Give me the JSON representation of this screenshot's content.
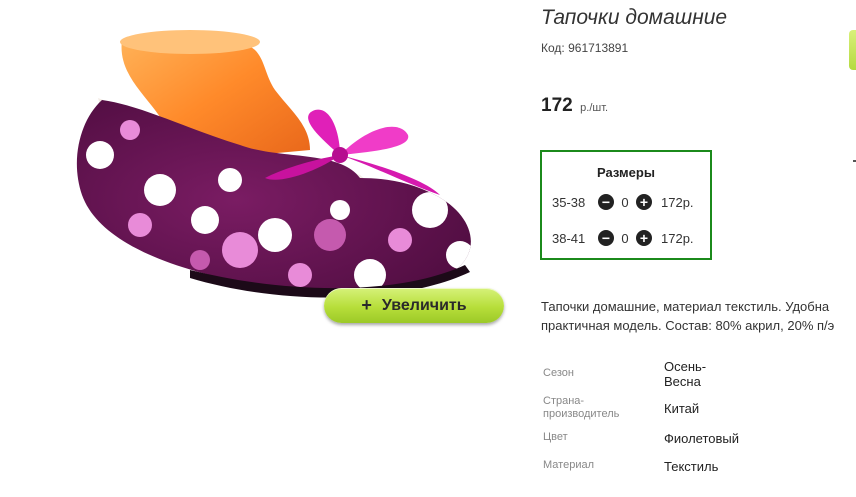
{
  "product": {
    "title": "Тапочки домашние",
    "code_label": "Код:",
    "code": "961713891",
    "price": "172",
    "price_unit": "р./шт.",
    "zoom_label": "Увеличить",
    "zoom_icon": "plus-icon"
  },
  "sizes": {
    "title": "Размеры",
    "rows": [
      {
        "range": "35-38",
        "qty": "0",
        "price": "172р."
      },
      {
        "range": "38-41",
        "qty": "0",
        "price": "172р."
      }
    ],
    "minus_icon": "minus-circle-icon",
    "plus_icon": "plus-circle-icon",
    "border_color": "#1b8a1b"
  },
  "description": {
    "line1": "Тапочки домашние, материал текстиль. Удобна",
    "line2": "практичная модель. Состав: 80% акрил, 20% п/э"
  },
  "specs": [
    {
      "label": "Сезон",
      "value": "Осень-\nВесна"
    },
    {
      "label": "Страна-\nпроизводитель",
      "value": "Китай"
    },
    {
      "label": "Цвет",
      "value": "Фиолетовый"
    },
    {
      "label": "Материал",
      "value": "Текстиль"
    }
  ],
  "colors": {
    "accent_green": "#b7de3a",
    "slipper_purple": "#6a1455",
    "ribbon_pink": "#e020b8"
  }
}
